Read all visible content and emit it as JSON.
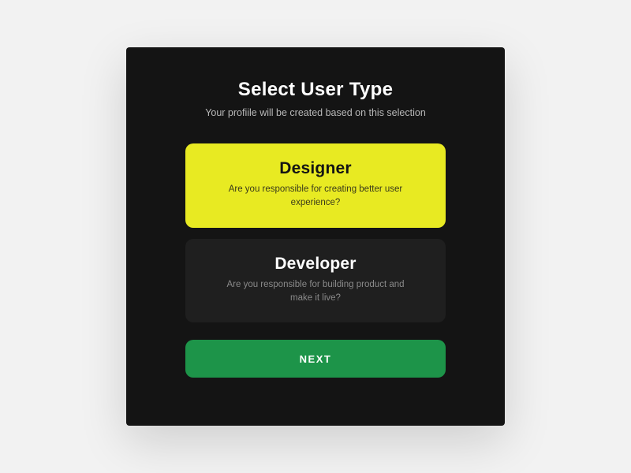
{
  "header": {
    "title": "Select User Type",
    "subtitle": "Your profiile will be created based on this selection"
  },
  "options": [
    {
      "id": "designer",
      "title": "Designer",
      "description": "Are you responsible for creating better user experience?",
      "selected": true
    },
    {
      "id": "developer",
      "title": "Developer",
      "description": "Are you responsible for building product and make it live?",
      "selected": false
    }
  ],
  "actions": {
    "next_label": "NEXT"
  },
  "colors": {
    "modal_bg": "#141414",
    "selected_card": "#e8ea22",
    "unselected_card": "#1f1f1f",
    "next_button": "#1d9449",
    "page_bg": "#f2f2f2"
  }
}
